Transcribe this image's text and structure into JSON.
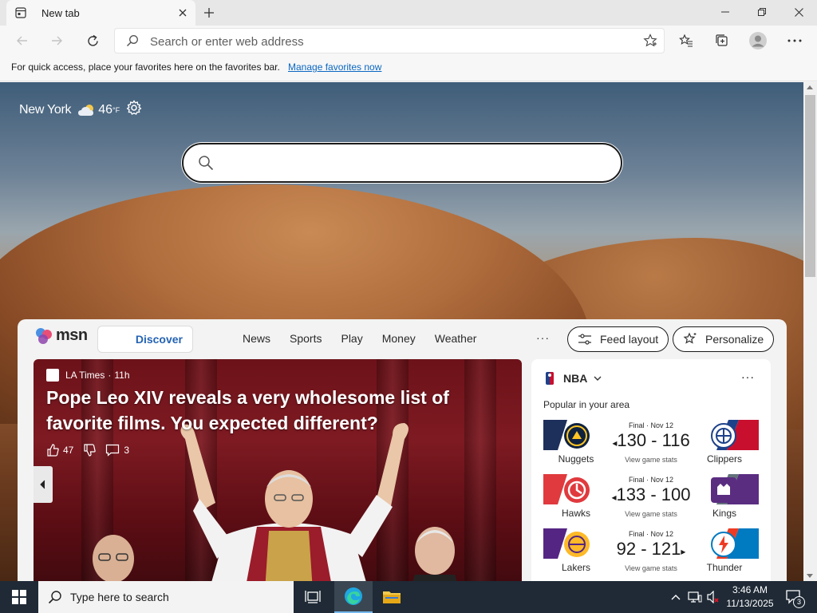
{
  "browser": {
    "tab_title": "New tab",
    "address_placeholder": "Search or enter web address",
    "favorites_message": "For quick access, place your favorites here on the favorites bar.",
    "favorites_link": "Manage favorites now"
  },
  "newtab": {
    "city": "New York",
    "temperature": "46",
    "temp_unit": "°F",
    "search_value": ""
  },
  "msn": {
    "logo_text": "msn",
    "discover_label": "Discover",
    "nav": [
      "News",
      "Sports",
      "Play",
      "Money",
      "Weather"
    ],
    "more": "···",
    "feed_layout": "Feed layout",
    "personalize": "Personalize"
  },
  "hero": {
    "source": "LA Times",
    "age": "11h",
    "headline": "Pope Leo XIV reveals a very wholesome list of favorite films. You expected different?",
    "likes": "47",
    "comments": "3"
  },
  "nba": {
    "title": "NBA",
    "more": "···",
    "subtitle": "Popular in your area",
    "games": [
      {
        "status": "Final · Nov 12",
        "score": "130 - 116",
        "home": "Nuggets",
        "away": "Clippers",
        "stats": "View game stats",
        "winner": "left",
        "left_color": "#1d2f5b",
        "right_color": "#c8102e"
      },
      {
        "status": "Final · Nov 12",
        "score": "133 - 100",
        "home": "Hawks",
        "away": "Kings",
        "stats": "View game stats",
        "winner": "left",
        "left_color": "#e03a3e",
        "right_color": "#5a2d81"
      },
      {
        "status": "Final · Nov 12",
        "score": "92 - 121",
        "home": "Lakers",
        "away": "Thunder",
        "stats": "View game stats",
        "winner": "right",
        "left_color": "#552583",
        "right_color": "#007ac1"
      }
    ]
  },
  "taskbar": {
    "search_placeholder": "Type here to search",
    "time": "3:46 AM",
    "date": "11/13/2025",
    "notifications": "3"
  }
}
